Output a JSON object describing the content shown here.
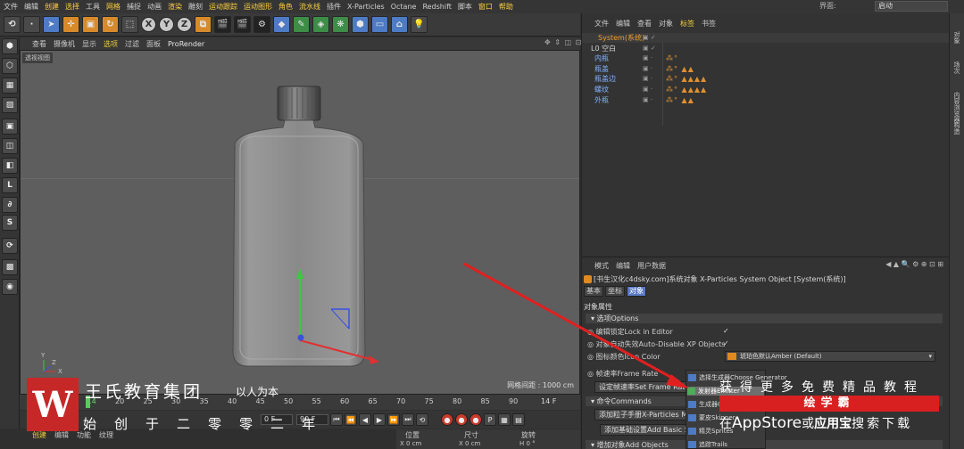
{
  "menubar": {
    "items": [
      {
        "label": "文件"
      },
      {
        "label": "编辑"
      },
      {
        "label": "创建",
        "hl": true
      },
      {
        "label": "选择",
        "hl": true
      },
      {
        "label": "工具"
      },
      {
        "label": "网格",
        "hl": true
      },
      {
        "label": "捕捉"
      },
      {
        "label": "动画"
      },
      {
        "label": "渲染",
        "hl": true
      },
      {
        "label": "雕刻"
      },
      {
        "label": "运动跟踪",
        "hl": true
      },
      {
        "label": "运动图形",
        "hl": true
      },
      {
        "label": "角色",
        "hl": true
      },
      {
        "label": "流水线",
        "hl": true
      },
      {
        "label": "插件"
      },
      {
        "label": "X-Particles"
      },
      {
        "label": "Octane"
      },
      {
        "label": "Redshift"
      },
      {
        "label": "脚本"
      },
      {
        "label": "窗口",
        "hl": true
      },
      {
        "label": "帮助",
        "hl": true
      }
    ],
    "interface_label": "界面:",
    "interface_value": "启动"
  },
  "toolbar": {
    "icons": [
      "undo-icon",
      "redo-icon",
      "select-icon",
      "move-icon",
      "scale-icon",
      "rotate-icon",
      "live-select-icon",
      "x-axis-icon",
      "y-axis-icon",
      "z-axis-icon",
      "coordinate-system-icon",
      "render-view-icon",
      "render-picture-icon",
      "render-settings-icon",
      "cube-icon",
      "pen-icon",
      "subdivision-icon",
      "cloner-icon",
      "deformer-icon",
      "floor-icon",
      "camera-icon",
      "light-icon"
    ],
    "glyphs": [
      "⟲",
      "·",
      "➤",
      "✛",
      "▣",
      "↻",
      "⬚",
      "X",
      "Y",
      "Z",
      "⧉",
      "🎬",
      "🎬",
      "⚙",
      "◆",
      "✎",
      "◈",
      "❋",
      "⬢",
      "▭",
      "⌂",
      "💡"
    ]
  },
  "lefttools": {
    "icons": [
      "make-editable-icon",
      "model-mode-icon",
      "texture-mode-icon",
      "workplane-icon",
      "points-mode-icon",
      "edges-mode-icon",
      "polygons-mode-icon",
      "enable-axis-icon",
      "tweak-icon",
      "snap-icon",
      "quantize-icon",
      "solo-icon",
      "paint-icon"
    ],
    "glyphs": [
      "⬢",
      "⬡",
      "▦",
      "▨",
      "▣",
      "◫",
      "◧",
      "L",
      "∂",
      "S",
      "⟳",
      "▩",
      "◉"
    ]
  },
  "viewport": {
    "menu": [
      {
        "label": "查看"
      },
      {
        "label": "摄像机"
      },
      {
        "label": "显示"
      },
      {
        "label": "选项",
        "act": true
      },
      {
        "label": "过滤"
      },
      {
        "label": "面板"
      },
      {
        "label": "ProRender",
        "pr": true
      }
    ],
    "view_name": "透视视图",
    "grid_spacing": "网格间距 : 1000 cm",
    "axis_y": "Y",
    "axis_x": "X",
    "axis_z": "Z"
  },
  "timeline": {
    "ticks": [
      "0",
      "14",
      "20",
      "25",
      "30",
      "35",
      "40",
      "45",
      "50",
      "55",
      "60",
      "65",
      "70",
      "75",
      "80",
      "85",
      "90"
    ],
    "current_frame_label": "14 F"
  },
  "playback": {
    "glyphs": [
      "⏮",
      "⏪",
      "◀",
      "▶",
      "⏩",
      "⏭",
      "⟲",
      "●",
      "●",
      "●",
      "P",
      "▦",
      "▤"
    ],
    "start_frame": "0 F",
    "end_frame": "90 F"
  },
  "bottom": {
    "menu": [
      {
        "label": "创建",
        "act": true
      },
      {
        "label": "编辑"
      },
      {
        "label": "功能"
      },
      {
        "label": "纹理"
      }
    ],
    "coord_headers": [
      "位置",
      "尺寸",
      "旋转"
    ],
    "coord_values": [
      "X  0 cm",
      "X  0 cm",
      "H  0 °"
    ]
  },
  "object_manager": {
    "menu": [
      {
        "label": "文件"
      },
      {
        "label": "编辑"
      },
      {
        "label": "查看"
      },
      {
        "label": "对象"
      },
      {
        "label": "标签",
        "hl": true
      },
      {
        "label": "书签"
      }
    ],
    "rows": [
      {
        "name": "System(系统)",
        "color": "#f0a030",
        "vis": "▣ ✓",
        "tags": ""
      },
      {
        "name": "L0 空白",
        "color": "#cfcfcf",
        "vis": "▣ ✓",
        "tags": ""
      },
      {
        "name": "内瓶",
        "color": "#7fb2ff",
        "vis": "▣ ·",
        "tags": "⁂°"
      },
      {
        "name": "瓶盖",
        "color": "#7fb2ff",
        "vis": "▣ ·",
        "tags": "⁂° ▲▲"
      },
      {
        "name": "瓶盖边",
        "color": "#7fb2ff",
        "vis": "▣ ·",
        "tags": "⁂° ▲▲▲▲"
      },
      {
        "name": "螺纹",
        "color": "#7fb2ff",
        "vis": "▣ ·",
        "tags": "⁂° ▲▲▲▲"
      },
      {
        "name": "外瓶",
        "color": "#7fb2ff",
        "vis": "▣ ·",
        "tags": "⁂° ▲▲"
      }
    ]
  },
  "side_tabs": [
    "对象",
    "场次",
    "内容浏览器",
    "构造"
  ],
  "attributes": {
    "menu": [
      {
        "label": "模式"
      },
      {
        "label": "编辑"
      },
      {
        "label": "用户数据"
      }
    ],
    "nav_glyphs": "◀ ▲ 🔍 ⚙ ⊕ ⊡ ⊞",
    "title": "[书生汉化c4dsky.com]系统对象 X-Particles System Object [System(系统)]",
    "tabs": [
      {
        "label": "基本",
        "on": false
      },
      {
        "label": "坐标",
        "on": false
      },
      {
        "label": "对象",
        "on": true
      }
    ],
    "section": "对象属性",
    "group_options": "▾ 选项Options",
    "lock_label": "◎ 编辑锁定Lock in Editor",
    "lock_check": "✓",
    "autodisable_label": "◎ 对象自动失效Auto-Disable XP Objects",
    "autodisable_check": "✓",
    "icon_color_label": "◎ 图标颜色Icon Color",
    "icon_color_value": "琥珀色默认Amber (Default)",
    "icon_color_hex": "#e08a20",
    "framerate_label": "◎ 帧速率Frame Rate",
    "framerate_btn": "设定帧速率Set Frame Rate",
    "group_commands": "▾ 命令Commands",
    "cmd_add_xp": "添加粒子手册X-Particles Ma",
    "cmd_add_basic": "添加基础设置Add Basic Se",
    "group_add": "▾ 增加对象Add Objects"
  },
  "dropdown": {
    "items": [
      {
        "label": "选择生成器Choose Generator",
        "sel": false
      },
      {
        "label": "发射器Emitter",
        "sel": true
      },
      {
        "label": "生成器Generator",
        "sel": false
      },
      {
        "label": "蒙皮Skinner",
        "sel": false
      },
      {
        "label": "精灵Sprites",
        "sel": false
      },
      {
        "label": "追踪Trails",
        "sel": false
      }
    ]
  },
  "watermark": {
    "logo_glyph": "W",
    "org": "王氏教育集团",
    "slogan": "以人为本",
    "motto": "始创于二零零二年"
  },
  "ad": {
    "line1": "获得更多免费精品教程",
    "banner": "绘学霸",
    "line3_pre": "在",
    "line3_store": "AppStore",
    "line3_mid": "或",
    "line3_app": "应用宝",
    "line3_post": "搜索下载"
  },
  "colors": {
    "arrow_red": "#e02020",
    "axis_green": "#3cc840",
    "axis_blue": "#3a50e0",
    "axis_red": "#e03030",
    "accent_yellow": "#f0d040"
  }
}
